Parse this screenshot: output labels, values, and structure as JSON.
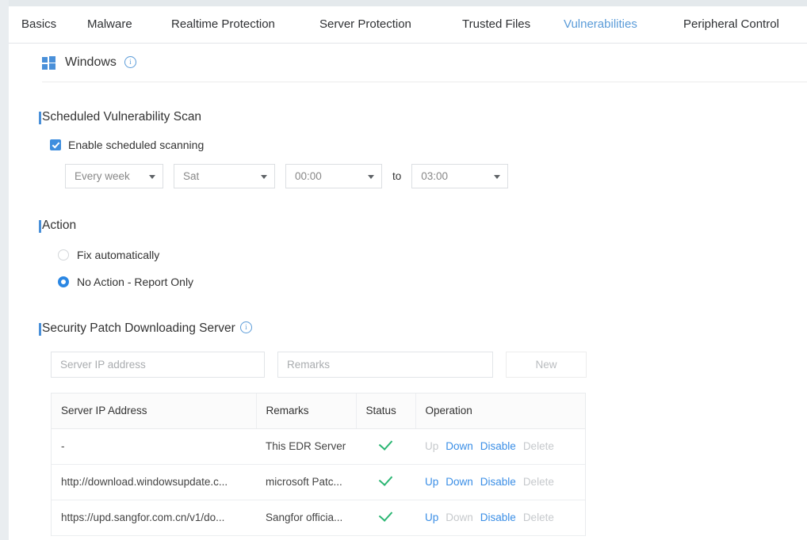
{
  "tabs": [
    {
      "label": "Basics",
      "active": false
    },
    {
      "label": "Malware",
      "active": false
    },
    {
      "label": "Realtime Protection",
      "active": false
    },
    {
      "label": "Server Protection",
      "active": false
    },
    {
      "label": "Trusted Files",
      "active": false
    },
    {
      "label": "Vulnerabilities",
      "active": true
    },
    {
      "label": "Peripheral Control",
      "active": false
    }
  ],
  "os_header": {
    "label": "Windows",
    "icon": "windows-logo-icon",
    "info_icon": "info-icon",
    "info_glyph": "i"
  },
  "scheduled_scan": {
    "title": "Scheduled Vulnerability Scan",
    "checkbox_label": "Enable scheduled scanning",
    "checkbox_checked": true,
    "frequency": "Every week",
    "day": "Sat",
    "start_time": "00:00",
    "to_label": "to",
    "end_time": "03:00"
  },
  "action": {
    "title": "Action",
    "options": [
      {
        "label": "Fix automatically",
        "selected": false
      },
      {
        "label": "No Action - Report Only",
        "selected": true
      }
    ]
  },
  "patch_server": {
    "title": "Security Patch Downloading Server",
    "info_glyph": "i",
    "ip_value": "",
    "ip_placeholder": "Server IP address",
    "remarks_value": "",
    "remarks_placeholder": "Remarks",
    "new_button": "New",
    "columns": [
      "Server IP Address",
      "Remarks",
      "Status",
      "Operation"
    ],
    "rows": [
      {
        "ip": "-",
        "remarks": "This EDR Server",
        "status": "ok",
        "ops": [
          {
            "label": "Up",
            "enabled": false
          },
          {
            "label": "Down",
            "enabled": true
          },
          {
            "label": "Disable",
            "enabled": true
          },
          {
            "label": "Delete",
            "enabled": false
          }
        ]
      },
      {
        "ip": "http://download.windowsupdate.c...",
        "remarks": "microsoft Patc...",
        "status": "ok",
        "ops": [
          {
            "label": "Up",
            "enabled": true
          },
          {
            "label": "Down",
            "enabled": true
          },
          {
            "label": "Disable",
            "enabled": true
          },
          {
            "label": "Delete",
            "enabled": false
          }
        ]
      },
      {
        "ip": "https://upd.sangfor.com.cn/v1/do...",
        "remarks": "Sangfor officia...",
        "status": "ok",
        "ops": [
          {
            "label": "Up",
            "enabled": true
          },
          {
            "label": "Down",
            "enabled": false
          },
          {
            "label": "Disable",
            "enabled": true
          },
          {
            "label": "Delete",
            "enabled": false
          }
        ]
      }
    ]
  },
  "colors": {
    "accent": "#4a90d9",
    "link": "#3a8ee6",
    "active_tab": "#5a9bd8",
    "status_ok": "#2bb673",
    "disabled": "#c6c9cc"
  }
}
